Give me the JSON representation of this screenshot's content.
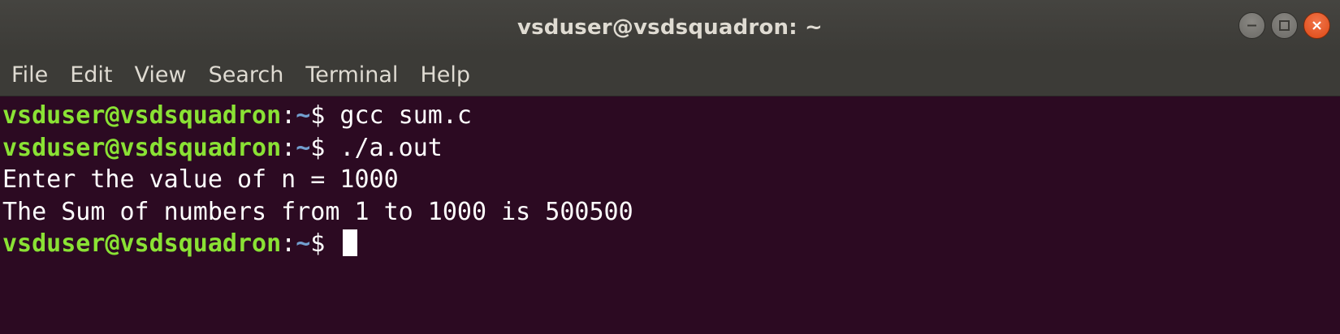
{
  "window": {
    "title": "vsduser@vsdsquadron: ~",
    "controls": {
      "minimize_icon": "minimize-icon",
      "maximize_icon": "maximize-icon",
      "close_icon": "close-icon"
    }
  },
  "menubar": {
    "items": [
      "File",
      "Edit",
      "View",
      "Search",
      "Terminal",
      "Help"
    ]
  },
  "terminal": {
    "user_host": "vsduser@vsdsquadron",
    "path": "~",
    "prompt_symbol": "$ ",
    "lines": [
      {
        "type": "command",
        "text": "gcc sum.c"
      },
      {
        "type": "command",
        "text": "./a.out"
      },
      {
        "type": "output",
        "text": "Enter the value of n = 1000"
      },
      {
        "type": "output",
        "text": "The Sum of numbers from 1 to 1000 is 500500"
      },
      {
        "type": "prompt",
        "text": ""
      }
    ]
  },
  "colors": {
    "terminal_bg": "#2c0a22",
    "prompt_user": "#8ae234",
    "prompt_path": "#729fcf",
    "close_button": "#dd4814"
  }
}
